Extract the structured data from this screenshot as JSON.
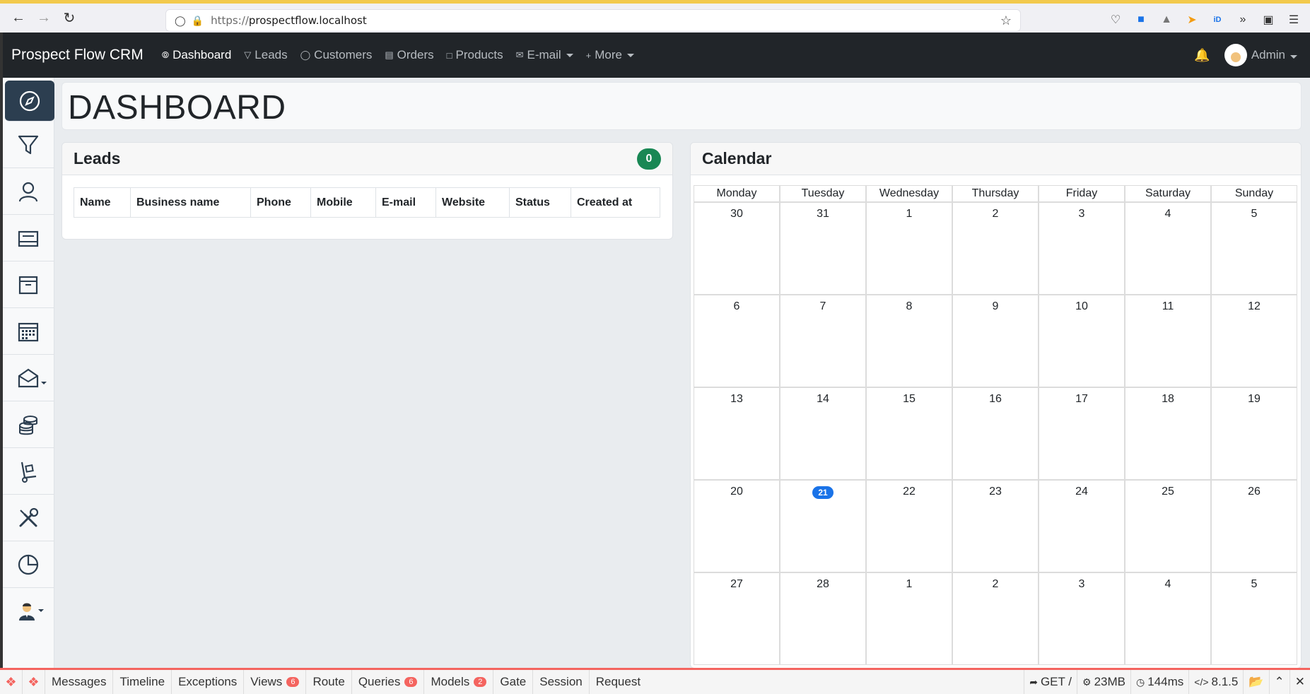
{
  "browser": {
    "url_scheme": "https://",
    "url_host": "prospectflow.localhost"
  },
  "navbar": {
    "brand": "Prospect Flow CRM",
    "items": [
      {
        "label": "Dashboard",
        "icon": "compass-icon"
      },
      {
        "label": "Leads",
        "icon": "filter-icon"
      },
      {
        "label": "Customers",
        "icon": "user-icon"
      },
      {
        "label": "Orders",
        "icon": "inbox-icon"
      },
      {
        "label": "Products",
        "icon": "box-icon"
      },
      {
        "label": "E-mail",
        "icon": "mail-icon"
      },
      {
        "label": "More",
        "icon": "plus-icon"
      }
    ],
    "user": "Admin"
  },
  "page": {
    "title": "DASHBOARD"
  },
  "leads": {
    "title": "Leads",
    "count": "0",
    "columns": [
      "Name",
      "Business name",
      "Phone",
      "Mobile",
      "E-mail",
      "Website",
      "Status",
      "Created at"
    ]
  },
  "calendar": {
    "title": "Calendar",
    "days": [
      "Monday",
      "Tuesday",
      "Wednesday",
      "Thursday",
      "Friday",
      "Saturday",
      "Sunday"
    ],
    "weeks": [
      [
        "30",
        "31",
        "1",
        "2",
        "3",
        "4",
        "5"
      ],
      [
        "6",
        "7",
        "8",
        "9",
        "10",
        "11",
        "12"
      ],
      [
        "13",
        "14",
        "15",
        "16",
        "17",
        "18",
        "19"
      ],
      [
        "20",
        "21",
        "22",
        "23",
        "24",
        "25",
        "26"
      ],
      [
        "27",
        "28",
        "1",
        "2",
        "3",
        "4",
        "5"
      ]
    ],
    "today": "21"
  },
  "debugbar": {
    "tabs": [
      {
        "label": "Messages",
        "badge": ""
      },
      {
        "label": "Timeline",
        "badge": ""
      },
      {
        "label": "Exceptions",
        "badge": ""
      },
      {
        "label": "Views",
        "badge": "6"
      },
      {
        "label": "Route",
        "badge": ""
      },
      {
        "label": "Queries",
        "badge": "6"
      },
      {
        "label": "Models",
        "badge": "2"
      },
      {
        "label": "Gate",
        "badge": ""
      },
      {
        "label": "Session",
        "badge": ""
      },
      {
        "label": "Request",
        "badge": ""
      }
    ],
    "method": "GET /",
    "memory": "23MB",
    "time": "144ms",
    "version": "8.1.5"
  },
  "colors": {
    "navbar_bg": "#212529",
    "sidebar_active": "#2c3e50",
    "badge_green": "#198754",
    "today_blue": "#1a73e8",
    "debug_red": "#f4645f"
  }
}
